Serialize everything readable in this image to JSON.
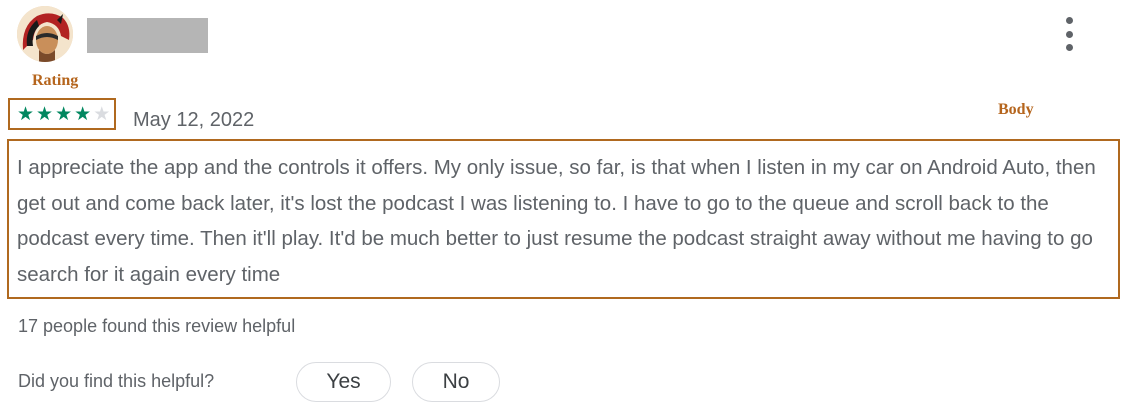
{
  "review": {
    "avatar_icon": "avatar-headdress-icon",
    "menu_icon": "more-vert-icon",
    "rating": {
      "label": "Rating",
      "stars_filled": 4,
      "stars_total": 5,
      "star_color": "#01875f"
    },
    "date": "May 12, 2022",
    "body_label": "Body",
    "text": "I appreciate the app and the controls it offers. My only issue, so far, is that when I listen in my car on Android Auto, then get out and come back later, it's lost the podcast I was listening to. I have to go to the queue and scroll back to the podcast every time. Then it'll play. It'd be much better to just resume the podcast straight away without me having to go search for it again every time",
    "helpful_count_text": "17 people found this review helpful",
    "helpful_question": "Did you find this helpful?",
    "yes_label": "Yes",
    "no_label": "No"
  },
  "colors": {
    "annotation": "#b0691f",
    "text": "#5f6368"
  }
}
